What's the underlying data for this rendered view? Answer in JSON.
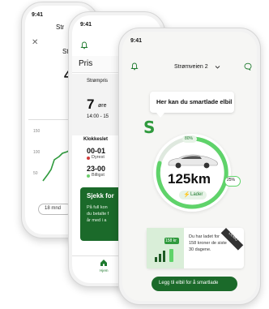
{
  "phone1": {
    "time": "9:41",
    "title_fragment": "Str",
    "small_frag": "St",
    "big_digit": "4",
    "axis": [
      "150",
      "100",
      "50",
      "0"
    ],
    "button_frag": "18 mnd"
  },
  "phone2": {
    "time": "9:41",
    "tab": "Pris",
    "strompris_label": "Strømpris",
    "price_big": "7",
    "price_unit": "øre",
    "price_time": "14:00 - 15",
    "section": "Klokkeslet",
    "row1_time": "00-01",
    "row1_label": "Dyrest",
    "row2_time": "23-00",
    "row2_label": "Billigst",
    "promo_title": "Sjekk for",
    "promo_body": [
      "På full kon",
      "du betalte f",
      "år med i a"
    ],
    "nav_label": "Hjem"
  },
  "phone3": {
    "time": "9:41",
    "location": "Strømveien 2",
    "speech": "Her kan du smartlade elbil",
    "logo_letter": "S",
    "battery_top": "80%",
    "range": "125km",
    "battery_low": "25%",
    "charge_status": "Lader",
    "stat_value": "158 kr",
    "stat_text": [
      "Du har ladet for",
      "158 kroner de siste",
      "30 dagene."
    ],
    "ribbon": "DEMO",
    "cta": "Legg til elbil for å smartlade"
  },
  "colors": {
    "brand_green": "#1e7a2e",
    "light_green": "#5fd36a",
    "cta_green": "#1b6a2a"
  },
  "icons": [
    "bell-icon",
    "chevron-down-icon",
    "chat-icon",
    "close-icon",
    "home-icon",
    "bolt-icon",
    "car-image"
  ]
}
